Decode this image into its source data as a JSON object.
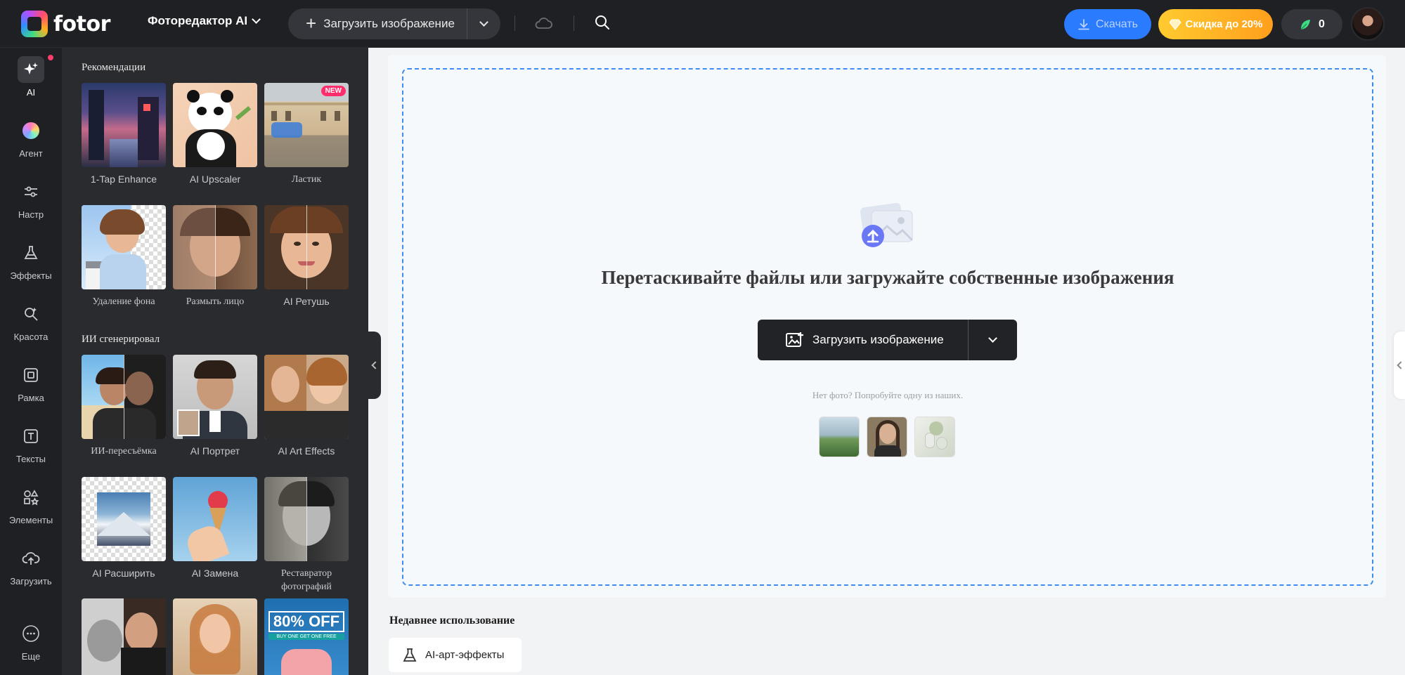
{
  "app": {
    "logo_text": "fotor",
    "editor_mode": "Фоторедактор AI"
  },
  "topbar": {
    "upload_label": "Загрузить изображение",
    "download_label": "Скачать",
    "discount_label": "Скидка до 20%",
    "credits": "0",
    "colors": {
      "download": "#2b7bff",
      "discount": "#ffb020"
    }
  },
  "rail": {
    "items": [
      {
        "label": "AI",
        "icon": "sparkle-icon"
      },
      {
        "label": "Агент",
        "icon": "color-orb-icon"
      },
      {
        "label": "Настр",
        "icon": "sliders-icon"
      },
      {
        "label": "Эффекты",
        "icon": "flask-icon"
      },
      {
        "label": "Красота",
        "icon": "magic-wand-icon"
      },
      {
        "label": "Рамка",
        "icon": "frame-icon"
      },
      {
        "label": "Тексты",
        "icon": "text-icon"
      },
      {
        "label": "Элементы",
        "icon": "shapes-icon"
      },
      {
        "label": "Загрузить",
        "icon": "cloud-upload-icon"
      },
      {
        "label": "Еще",
        "icon": "more-icon"
      }
    ]
  },
  "panel": {
    "section1": "Рекомендации",
    "section2": "ИИ сгенерировал",
    "new_badge": "NEW",
    "tools": [
      {
        "label": "1-Tap Enhance"
      },
      {
        "label": "AI Upscaler"
      },
      {
        "label": "Ластик"
      },
      {
        "label": "Удаление фона"
      },
      {
        "label": "Размыть лицо"
      },
      {
        "label": "AI Ретушь"
      },
      {
        "label": "ИИ-пересъёмка"
      },
      {
        "label": "AI Портрет"
      },
      {
        "label": "AI Art Effects"
      },
      {
        "label": "AI Расширить"
      },
      {
        "label": "AI Замена"
      },
      {
        "label": "Реставратор фотографий"
      }
    ],
    "promo_text": "80% OFF",
    "promo_sub": "BUY ONE GET ONE FREE"
  },
  "canvas": {
    "title": "Перетаскивайте файлы или загружайте собственные изображения",
    "upload_label": "Загрузить изображение",
    "try_text": "Нет фото? Попробуйте одну из наших."
  },
  "recent": {
    "title": "Недавнее использование",
    "item": "AI-арт-эффекты"
  }
}
